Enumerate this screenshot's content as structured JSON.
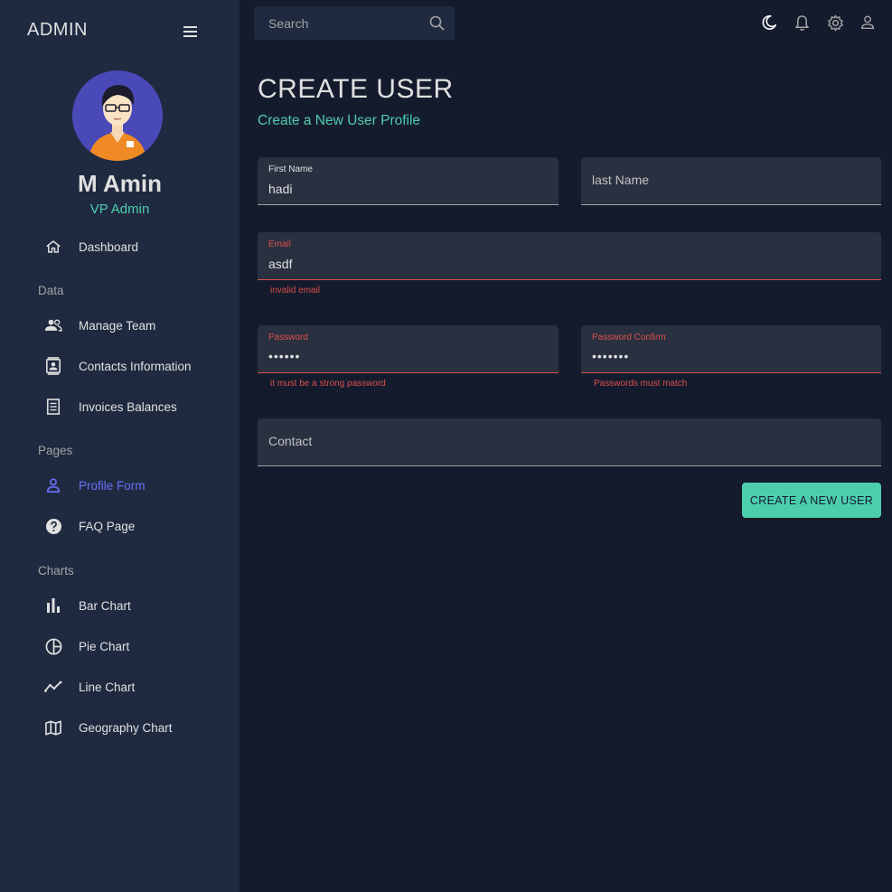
{
  "sidebar": {
    "brand": "ADMIN",
    "user": {
      "name": "M Amin",
      "role": "VP Admin"
    },
    "items": [
      {
        "label": "Dashboard",
        "icon": "home-icon"
      },
      {
        "section": "Data"
      },
      {
        "label": "Manage Team",
        "icon": "team-icon"
      },
      {
        "label": "Contacts Information",
        "icon": "contacts-icon"
      },
      {
        "label": "Invoices Balances",
        "icon": "receipt-icon"
      },
      {
        "section": "Pages"
      },
      {
        "label": "Profile Form",
        "icon": "person-icon",
        "active": true
      },
      {
        "label": "FAQ Page",
        "icon": "help-icon"
      },
      {
        "section": "Charts"
      },
      {
        "label": "Bar Chart",
        "icon": "bar-chart-icon"
      },
      {
        "label": "Pie Chart",
        "icon": "pie-chart-icon"
      },
      {
        "label": "Line Chart",
        "icon": "timeline-icon"
      },
      {
        "label": "Geography Chart",
        "icon": "map-icon"
      }
    ]
  },
  "topbar": {
    "search_placeholder": "Search",
    "icons": [
      "dark-mode-icon",
      "notifications-icon",
      "settings-icon",
      "person-icon"
    ]
  },
  "header": {
    "title": "CREATE USER",
    "subtitle": "Create a New User Profile"
  },
  "form": {
    "first_name": {
      "label": "First Name",
      "value": "hadi"
    },
    "last_name": {
      "label": "last Name",
      "value": ""
    },
    "email": {
      "label": "Email",
      "value": "asdf",
      "error": "invalid email"
    },
    "password": {
      "label": "Password",
      "value": "••••••",
      "error": "it must be a strong password"
    },
    "password_confirm": {
      "label": "Password Confirm",
      "value": "•••••••",
      "error": "Passwords must match"
    },
    "contact": {
      "label": "Contact",
      "value": ""
    },
    "submit_label": "CREATE A NEW USER"
  },
  "colors": {
    "background": "#141b2d",
    "sidebar": "#1f2a40",
    "field": "#293040",
    "accent_green": "#4cceac",
    "accent_blue": "#6870fa",
    "error": "#db4f4a",
    "text": "#e0e0e0"
  }
}
